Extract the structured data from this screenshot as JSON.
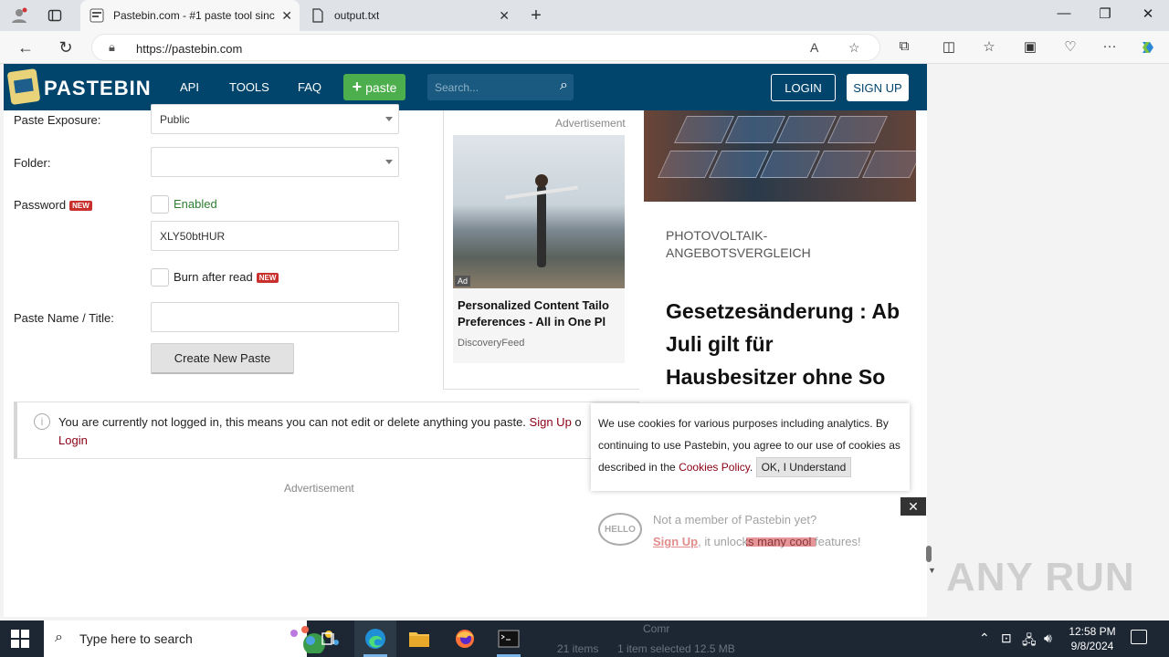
{
  "browser": {
    "tabs": [
      {
        "title": "Pastebin.com - #1 paste tool sinc"
      },
      {
        "title": "output.txt"
      }
    ],
    "url": "https://pastebin.com"
  },
  "pastebin": {
    "brand": "PASTEBIN",
    "nav": [
      "API",
      "TOOLS",
      "FAQ"
    ],
    "paste_button": "paste",
    "search_placeholder": "Search...",
    "login": "LOGIN",
    "signup": "SIGN UP"
  },
  "form": {
    "exposure_label": "Paste Exposure:",
    "exposure_value": "Public",
    "folder_label": "Folder:",
    "folder_value": "",
    "password_label": "Password",
    "new_badge": "NEW",
    "enabled_label": "Enabled",
    "password_value": "XLY50btHUR",
    "burn_label": "Burn after read",
    "title_label": "Paste Name / Title:",
    "title_value": "",
    "create_button": "Create New Paste"
  },
  "notice": {
    "text": "You are currently not logged in, this means you can not edit or delete anything you paste.",
    "signup_link": "Sign Up",
    "or_text": "o",
    "login_link": "Login"
  },
  "ads": {
    "label": "Advertisement",
    "tag": "Ad",
    "title_line1": "Personalized Content Tailo",
    "title_line2": "Preferences - All in One Pl",
    "source": "DiscoveryFeed"
  },
  "promo": {
    "kicker": "PHOTOVOLTAIK-ANGEBOTSVERGLEICH",
    "headline": "Gesetzesänderung : Ab Juli gilt für Hausbesitzer ohne So"
  },
  "cookie": {
    "text": "We use cookies for various purposes including analytics. By continuing to use Pastebin, you agree to our use of cookies as described in the",
    "link": "Cookies Policy",
    "ok": "OK, I Understand"
  },
  "hello": {
    "bubble": "HELLO",
    "line1": "Not a member of Pastebin yet?",
    "signup": "Sign Up",
    "line2": ", it unlocks many cool features!"
  },
  "watermark": "ANY RUN",
  "taskbar": {
    "search_placeholder": "Type here to search",
    "ghost_label": "Comr",
    "ghost_items": "21 items",
    "ghost_selected": "1 item selected  12.5 MB",
    "time": "12:58 PM",
    "date": "9/8/2024"
  }
}
